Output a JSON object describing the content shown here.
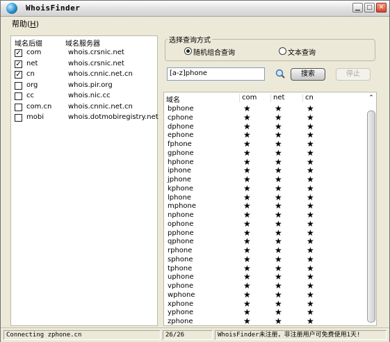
{
  "window": {
    "title": "WhoisFinder"
  },
  "menu": {
    "help_label": "帮助",
    "help_shortcut": "H"
  },
  "suffix_list": {
    "col_suffix": "域名后缀",
    "col_server": "域名服务器",
    "items": [
      {
        "suffix": "com",
        "server": "whois.crsnic.net",
        "checked": true
      },
      {
        "suffix": "net",
        "server": "whois.crsnic.net",
        "checked": true
      },
      {
        "suffix": "cn",
        "server": "whois.cnnic.net.cn",
        "checked": true
      },
      {
        "suffix": "org",
        "server": "whois.pir.org",
        "checked": false
      },
      {
        "suffix": "cc",
        "server": "whois.nic.cc",
        "checked": false
      },
      {
        "suffix": "com.cn",
        "server": "whois.cnnic.net.cn",
        "checked": false
      },
      {
        "suffix": "mobi",
        "server": "whois.dotmobiregistry.net",
        "checked": false
      }
    ]
  },
  "query_mode": {
    "legend": "选择查询方式",
    "option_random": "随机组合查询",
    "option_text": "文本查询",
    "selected": "random"
  },
  "query": {
    "value": "[a-z]phone"
  },
  "buttons": {
    "search_label": "搜索",
    "stop_label": "停止"
  },
  "results": {
    "col_domain": "域名",
    "col_com": "com",
    "col_net": "net",
    "col_cn": "cn",
    "star_glyph": "★",
    "rows": [
      "bphone",
      "cphone",
      "dphone",
      "ephone",
      "fphone",
      "gphone",
      "hphone",
      "iphone",
      "jphone",
      "kphone",
      "lphone",
      "mphone",
      "nphone",
      "ophone",
      "pphone",
      "qphone",
      "rphone",
      "sphone",
      "tphone",
      "uphone",
      "vphone",
      "wphone",
      "xphone",
      "yphone",
      "zphone"
    ]
  },
  "status": {
    "connecting": "Connecting zphone.cn",
    "progress": "26/26",
    "notice": "WhoisFinder未注册，非注册用户可免费使用1天!"
  }
}
